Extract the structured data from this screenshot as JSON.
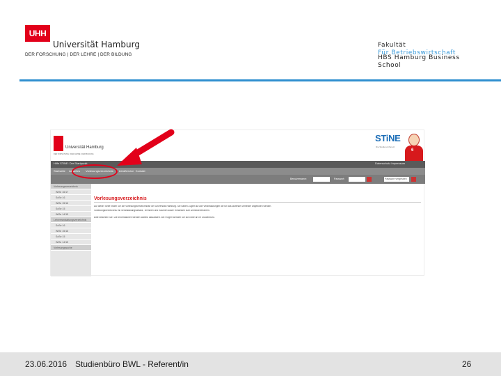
{
  "header": {
    "logo_text": "UHH",
    "university": "Universität Hamburg",
    "motto": "DER FORSCHUNG | DER LEHRE | DER BILDUNG",
    "faculty_line1": "Fakultät",
    "faculty_line2": "Für Betriebswirtschaft",
    "faculty_line3": "HBS Hamburg Business",
    "faculty_line4": "School",
    "rule_color": "#2f8fcf"
  },
  "screenshot": {
    "uni_name": "Universität Hamburg",
    "uni_sub": "DER FORSCHUNG | DER LEHRE | DER BILDUNG",
    "stine_logo": "STiNE",
    "stine_sub": "Die Studien-Infonetz",
    "mascot_number": "6",
    "topbar": {
      "left": "Hilfe   STiNE: Der Startpunkt",
      "right": "Datenschutz   Impressum"
    },
    "nav": [
      "Startseite",
      "Aktuelles",
      "Vorlesungsverzeichnis",
      "Infos",
      "Service",
      "Kontakt"
    ],
    "login": {
      "user_label": "Benutzername:",
      "pass_label": "Passwort:",
      "forgot_label": "Passwort vergessen"
    },
    "sidebar": [
      "Vorlesungsverzeichnis",
      "WiSe 16/17",
      "SoSe 16",
      "WiSe 15/16",
      "SoSe 15",
      "WiSe 14/15",
      "Lehrveranstaltungsverzeichnis",
      "SoSe 16",
      "WiSe 15/16",
      "SoSe 15",
      "WiSe 14/15",
      "Vorlesungssuche"
    ],
    "content_title": "Vorlesungsverzeichnis",
    "content_lines": [
      "Auf dieser Seite finden Sie die Vorlesungsverzeichnisse der Universität Hamburg. Sie haben Zugriff auf alle Veranstaltungen die für das laufende Semester angeboten werden.",
      "Vorlesungsverzeichnis mit Veranstaltungsdetails, Terminen und Räumen sowie Hinweisen zum Anmeldeverfahren.",
      "Bitte beachten Sie: Die Informationen werden laufend aktualisiert. Bei Fragen wenden Sie sich bitte an Ihr Studienbüro."
    ]
  },
  "footer": {
    "date": "23.06.2016",
    "title": "Studienbüro BWL - Referent/in",
    "page": "26"
  }
}
